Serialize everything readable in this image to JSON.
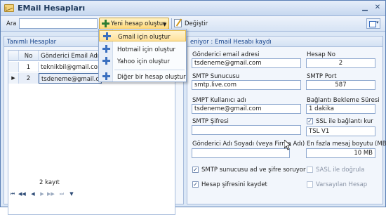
{
  "window": {
    "title": "EMail Hesapları"
  },
  "toolbar": {
    "search_label": "Ara",
    "search_value": "",
    "new_account_label": "Yeni hesap oluştur",
    "edit_label": "Değiştir"
  },
  "menu": {
    "items": [
      {
        "label": "Gmail için oluştur"
      },
      {
        "label": "Hotmail için oluştur"
      },
      {
        "label": "Yahoo için oluştur"
      },
      {
        "label": "Diğer bir hesap oluştur"
      }
    ]
  },
  "list": {
    "title": "Tanımlı Hesaplar",
    "columns": {
      "no": "No",
      "email": "Gönderici Email Adresi"
    },
    "rows": [
      {
        "no": "1",
        "email": "teknikbil@gmail.com"
      },
      {
        "no": "2",
        "email": "tsdeneme@gmail.com"
      }
    ],
    "record_count": "2 kayıt"
  },
  "form": {
    "header": "eniyor : Email Hesabı kaydı",
    "sender_email_label": "Gönderici email adresi",
    "sender_email_value": "tsdeneme@gmail.com",
    "account_no_label": "Hesap No",
    "account_no_value": "2",
    "smtp_server_label": "SMTP Sunucusu",
    "smtp_server_value": "smtp.live.com",
    "smtp_port_label": "SMTP Port",
    "smtp_port_value": "587",
    "smtp_user_label": "SMPT Kullanıcı adı",
    "smtp_user_value": "tsdeneme@gmail.com",
    "timeout_label": "Bağlantı Bekleme Süresi",
    "timeout_value": "1 dakika",
    "smtp_password_label": "SMTP Şifresi",
    "smtp_password_value": "",
    "ssl_label": "SSL ile bağlantı kur",
    "ssl_checked": true,
    "tls_value": "TSL V1",
    "sender_name_label": "Gönderici Adı Soyadı (veya Firma Adı)",
    "sender_name_value": "",
    "max_size_label": "En fazla mesaj boyutu (MB)",
    "max_size_value": "10 MB",
    "smtp_ask_label": "SMTP sunucusu ad ve şifre soruyor",
    "smtp_ask_checked": true,
    "sasl_label": "SASL ile doğrula",
    "sasl_checked": false,
    "save_password_label": "Hesap şifresini kaydet",
    "save_password_checked": true,
    "default_account_label": "Varsayılan Hesap",
    "default_account_checked": false
  }
}
